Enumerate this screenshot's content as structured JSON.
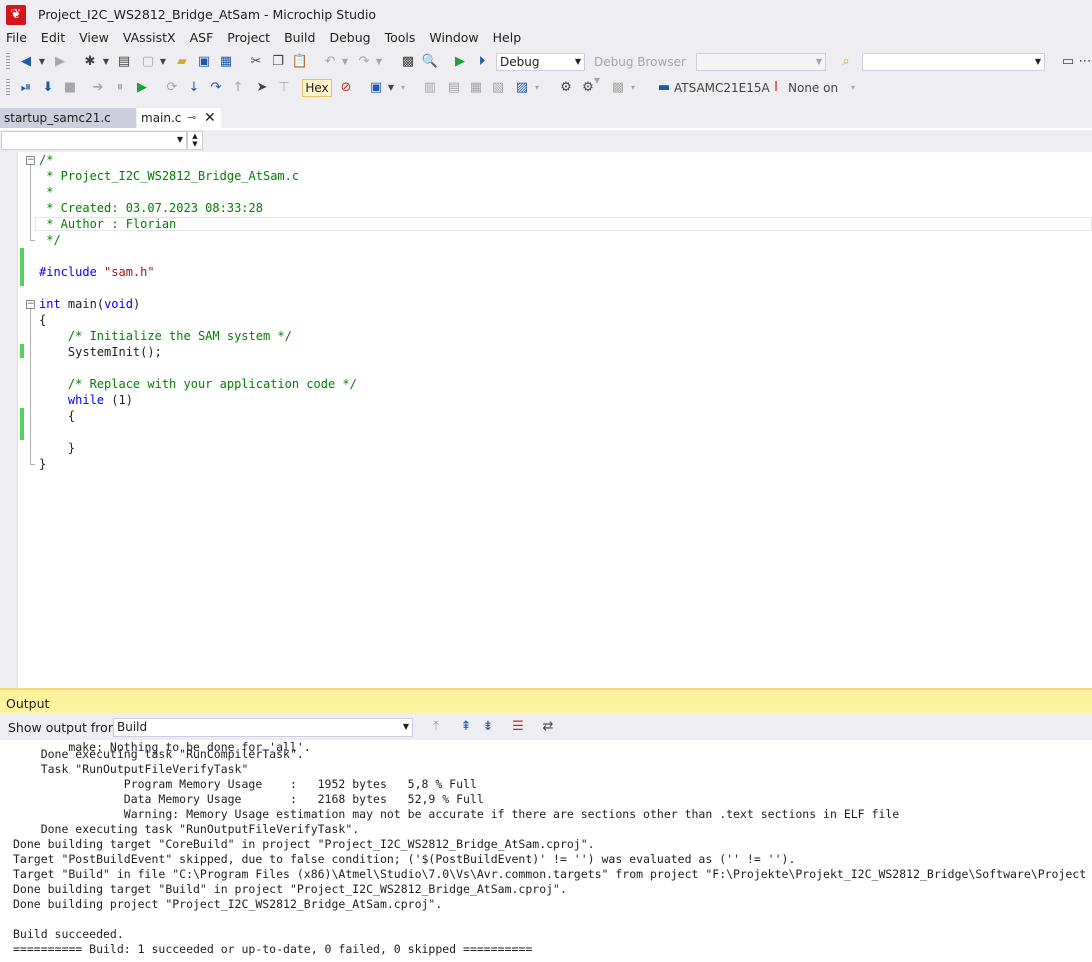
{
  "window": {
    "title": "Project_I2C_WS2812_Bridge_AtSam - Microchip Studio"
  },
  "menu": [
    "File",
    "Edit",
    "View",
    "VAssistX",
    "ASF",
    "Project",
    "Build",
    "Debug",
    "Tools",
    "Window",
    "Help"
  ],
  "toolbar": {
    "configuration": "Debug",
    "debug_browser": "Debug Browser",
    "hex_label": "Hex",
    "device": "ATSAMC21E15A",
    "tool": "None on"
  },
  "tabs": [
    {
      "label": "startup_samc21.c",
      "active": false
    },
    {
      "label": "main.c",
      "active": true
    }
  ],
  "editor": {
    "lines": [
      "/*",
      " * Project_I2C_WS2812_Bridge_AtSam.c",
      " *",
      " * Created: 03.07.2023 08:33:28",
      " * Author : Florian",
      " */",
      "",
      "#include \"sam.h\"",
      "",
      "int main(void)",
      "{",
      "    /* Initialize the SAM system */",
      "    SystemInit();",
      "",
      "    /* Replace with your application code */",
      "    while (1)",
      "    {",
      "",
      "    }",
      "}"
    ]
  },
  "output": {
    "title": "Output",
    "show_from_label": "Show output from:",
    "source": "Build",
    "lines": [
      "        make: Nothing to be done for 'all'.",
      "    Done executing task \"RunCompilerTask\".",
      "    Task \"RunOutputFileVerifyTask\"",
      "                Program Memory Usage    :   1952 bytes   5,8 % Full",
      "                Data Memory Usage       :   2168 bytes   52,9 % Full",
      "                Warning: Memory Usage estimation may not be accurate if there are sections other than .text sections in ELF file",
      "    Done executing task \"RunOutputFileVerifyTask\".",
      "Done building target \"CoreBuild\" in project \"Project_I2C_WS2812_Bridge_AtSam.cproj\".",
      "Target \"PostBuildEvent\" skipped, due to false condition; ('$(PostBuildEvent)' != '') was evaluated as ('' != '').",
      "Target \"Build\" in file \"C:\\Program Files (x86)\\Atmel\\Studio\\7.0\\Vs\\Avr.common.targets\" from project \"F:\\Projekte\\Projekt_I2C_WS2812_Bridge\\Software\\Project",
      "Done building target \"Build\" in project \"Project_I2C_WS2812_Bridge_AtSam.cproj\".",
      "Done building project \"Project_I2C_WS2812_Bridge_AtSam.cproj\".",
      "",
      "Build succeeded.",
      "========== Build: 1 succeeded or up-to-date, 0 failed, 0 skipped =========="
    ]
  }
}
